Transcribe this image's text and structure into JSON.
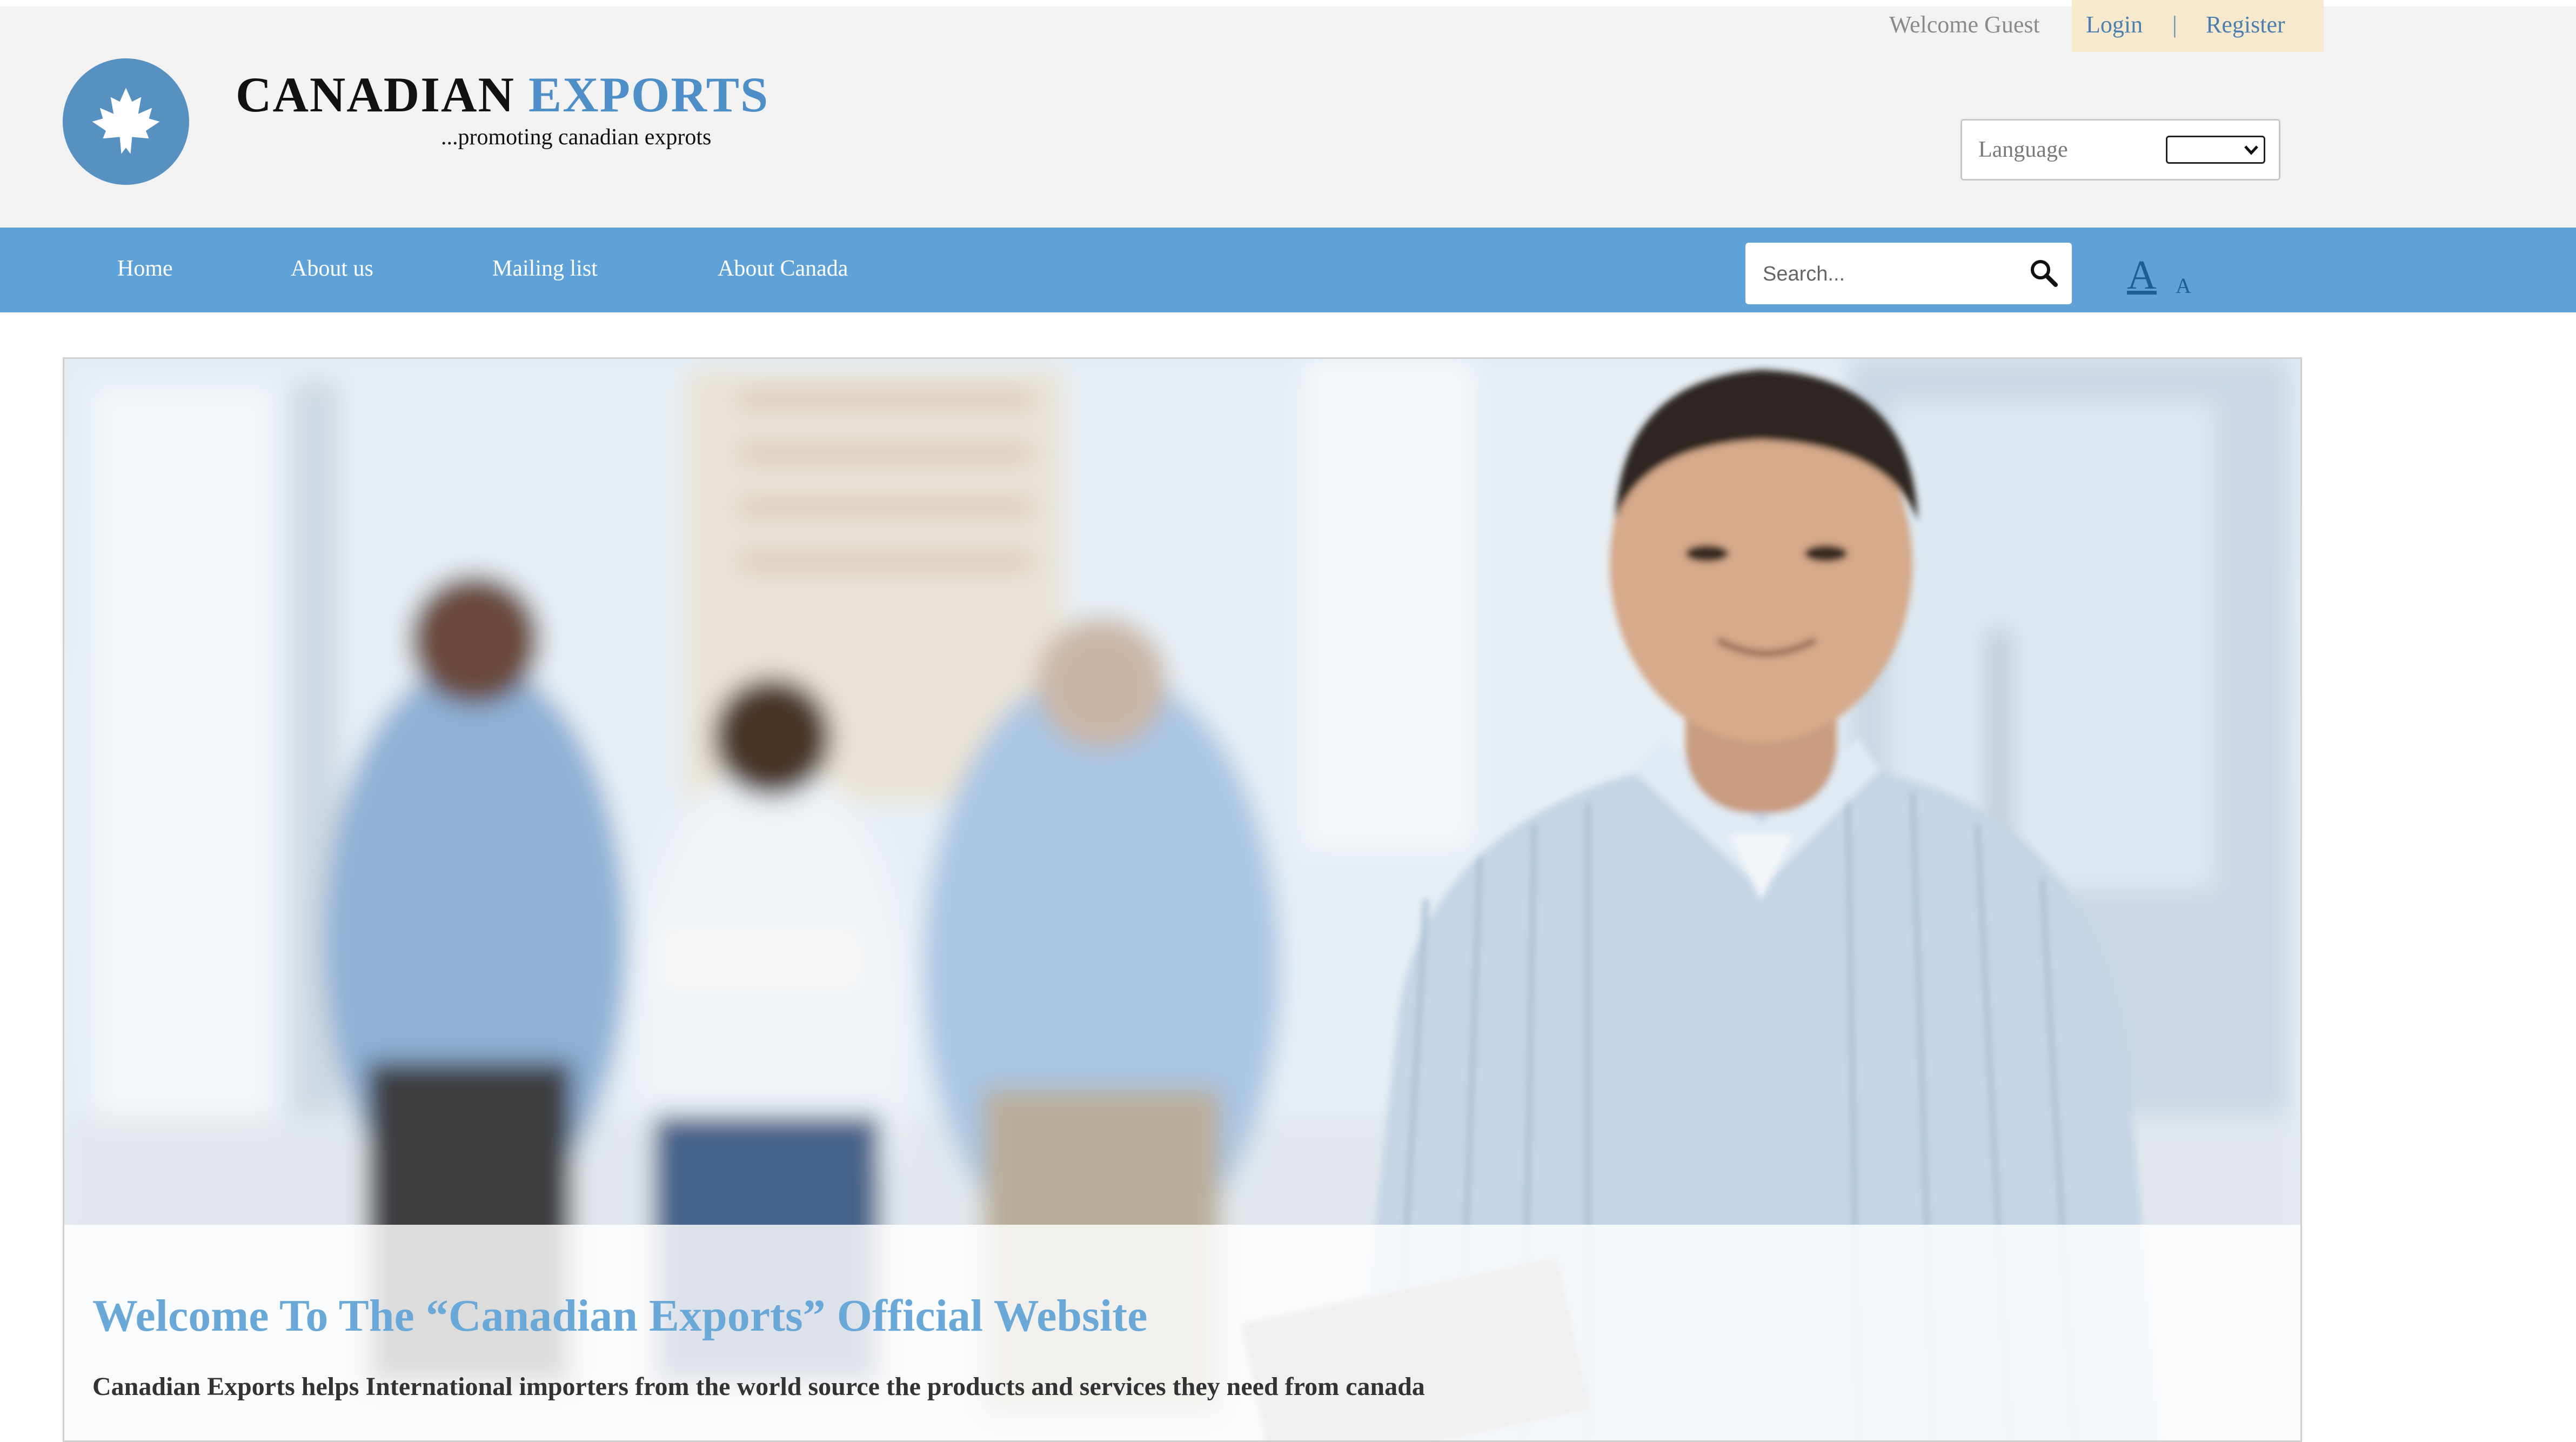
{
  "colors": {
    "header_bg": "#f2f2f2",
    "nav_bg": "#5fa2d8",
    "brand_accent": "#4f8fc8",
    "hero_title": "#6aa9d7",
    "link": "#4a7fb0"
  },
  "user_bar": {
    "welcome": "Welcome Guest",
    "login": "Login",
    "separator": "|",
    "register": "Register"
  },
  "brand": {
    "logo_icon": "maple-leaf-icon",
    "title_part1": "CANADIAN",
    "title_part2": "EXPORTS",
    "tagline": "...promoting canadian exprots"
  },
  "language": {
    "label": "Language",
    "selected": ""
  },
  "nav": {
    "items": [
      {
        "label": "Home"
      },
      {
        "label": "About us"
      },
      {
        "label": "Mailing list"
      },
      {
        "label": "About Canada"
      }
    ]
  },
  "search": {
    "placeholder": "Search...",
    "icon": "search-icon"
  },
  "font_size": {
    "large": "A",
    "small": "A"
  },
  "hero": {
    "title": "Welcome To The “Canadian Exports” Official Website",
    "text": "Canadian Exports helps International importers from the world source the products and services they need from canada"
  }
}
